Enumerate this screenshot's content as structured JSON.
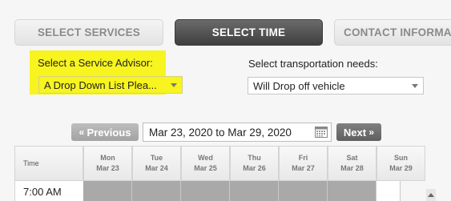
{
  "steps": [
    {
      "label": "SELECT SERVICES"
    },
    {
      "label": "SELECT TIME"
    },
    {
      "label": "CONTACT INFORMATI"
    }
  ],
  "advisor": {
    "label": "Select a Service Advisor:",
    "value": "A Drop Down List Plea..."
  },
  "transport": {
    "label": "Select transportation needs:",
    "value": "Will Drop off vehicle"
  },
  "nav": {
    "prev": "Previous",
    "next": "Next",
    "date_range": "Mar 23, 2020 to Mar 29, 2020"
  },
  "schedule": {
    "time_header": "Time",
    "days": [
      {
        "day": "Mon",
        "date": "Mar 23"
      },
      {
        "day": "Tue",
        "date": "Mar 24"
      },
      {
        "day": "Wed",
        "date": "Mar 25"
      },
      {
        "day": "Thu",
        "date": "Mar 26"
      },
      {
        "day": "Fri",
        "date": "Mar 27"
      },
      {
        "day": "Sat",
        "date": "Mar 28"
      },
      {
        "day": "Sun",
        "date": "Mar 29"
      }
    ],
    "first_time": "7:00 AM"
  },
  "colors": {
    "highlight": "#f7f41f",
    "active_step": "#4a4a4a",
    "slot": "#a9a9a9"
  }
}
